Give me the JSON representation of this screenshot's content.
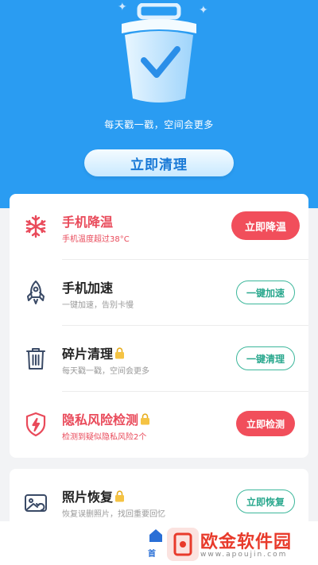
{
  "hero": {
    "slogan": "每天戳一戳，空间会更多",
    "clean_button": "立即清理",
    "background_color": "#2a9cf2"
  },
  "features": [
    {
      "icon": "snowflake-icon",
      "title": "手机降温",
      "subtitle": "手机温度超过38°C",
      "action": "立即降温",
      "alert": true,
      "locked": false
    },
    {
      "icon": "rocket-icon",
      "title": "手机加速",
      "subtitle": "一键加速，告别卡慢",
      "action": "一键加速",
      "alert": false,
      "locked": false
    },
    {
      "icon": "trash-icon",
      "title": "碎片清理",
      "subtitle": "每天戳一戳，空间会更多",
      "action": "一键清理",
      "alert": false,
      "locked": true
    },
    {
      "icon": "shield-icon",
      "title": "隐私风险检测",
      "subtitle": "检测到疑似隐私风险2个",
      "action": "立即检测",
      "alert": true,
      "locked": true
    }
  ],
  "secondary": [
    {
      "icon": "photo-icon",
      "title": "照片恢复",
      "subtitle": "恢复误删照片，找回重要回忆",
      "action": "立即恢复",
      "locked": true
    }
  ],
  "bottom_nav": {
    "home_label": "首"
  },
  "watermark": {
    "text": "欧金软件园",
    "url": "www.apoujin.com"
  },
  "colors": {
    "alert_red": "#e94a5a",
    "button_red": "#f14e5b",
    "outline_green": "#3cb79b",
    "accent_blue": "#1778d6"
  }
}
